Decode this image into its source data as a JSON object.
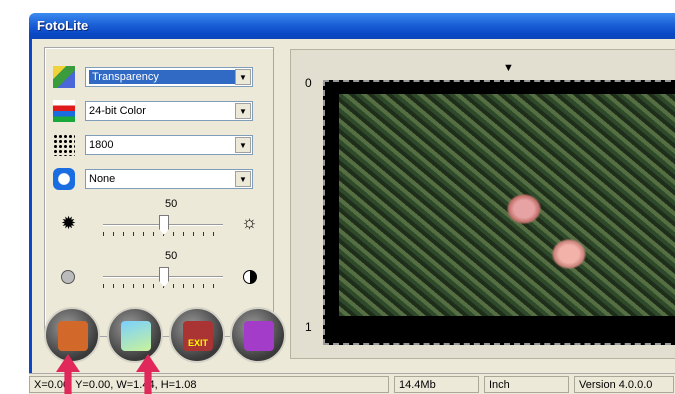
{
  "window": {
    "title": "FotoLite"
  },
  "controls": {
    "type": {
      "value": "Transparency",
      "icon": "film-transparency-icon"
    },
    "color": {
      "value": "24-bit Color",
      "icon": "color-mode-icon"
    },
    "resolution": {
      "value": "1800",
      "icon": "halftone-dots-icon"
    },
    "filter": {
      "value": "None",
      "icon": "lens-filter-icon"
    }
  },
  "sliders": {
    "brightness": {
      "value": "50",
      "left_icon": "dim-sun-icon",
      "right_icon": "bright-sun-icon"
    },
    "contrast": {
      "value": "50",
      "left_icon": "low-contrast-icon",
      "right_icon": "high-contrast-icon"
    }
  },
  "preview": {
    "ruler_top": "0",
    "ruler_bottom": "1"
  },
  "buttons": [
    "preview-button",
    "scan-button",
    "exit-button",
    "help-button"
  ],
  "exit_label": "EXIT",
  "status": {
    "coords": "X=0.00, Y=0.00, W=1.44, H=1.08",
    "size": "14.4Mb",
    "unit": "Inch",
    "version": "Version 4.0.0.0"
  }
}
